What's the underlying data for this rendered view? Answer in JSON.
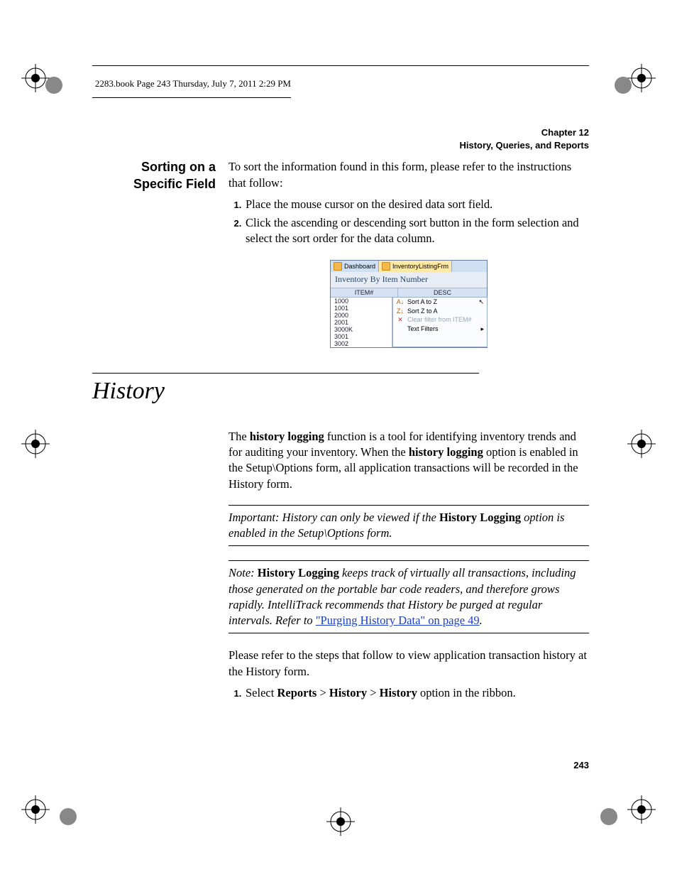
{
  "running_header": "2283.book  Page 243  Thursday, July 7, 2011  2:29 PM",
  "chapter_line1": "Chapter 12",
  "chapter_line2": "History, Queries, and Reports",
  "side_heading": "Sorting on a Specific Field",
  "intro_para": "To sort the information found in this form, please refer to the instructions that follow:",
  "steps": [
    "Place the mouse cursor on the desired data sort field.",
    "Click the ascending or descending sort button in the form selection and select the sort order for the data column."
  ],
  "fig": {
    "tab1": "Dashboard",
    "tab2": "InventoryListingFrm",
    "title": "Inventory By Item Number",
    "col_item": "ITEM#",
    "col_desc": "DESC",
    "items": [
      "1000",
      "1001",
      "2000",
      "2001",
      "3000K",
      "3001",
      "3002"
    ],
    "menu": {
      "sort_az": "Sort A to Z",
      "sort_za": "Sort Z to A",
      "clear": "Clear filter from ITEM#",
      "text_filters": "Text Filters"
    }
  },
  "section_title": "History",
  "history_para_parts": {
    "p1a": "The ",
    "p1b": "history logging",
    "p1c": " function is a tool for identifying inventory trends and for auditing your inventory. When the ",
    "p1d": "history logging",
    "p1e": " option is enabled in the Setup\\Options form, all application transactions will be recorded in the History form."
  },
  "important": {
    "label": "Important:   ",
    "t1": "History can only be viewed if the ",
    "bold": "History Logging",
    "t2": " option is enabled in the Setup\\Options form."
  },
  "note": {
    "label": "Note:   ",
    "bold": "History Logging",
    "t1": " keeps track of virtually all transactions, including those generated on the portable bar code readers, and therefore grows rapidly. IntelliTrack recommends that History be purged at regular intervals. Refer to ",
    "link": "\"Purging History Data\" on page 49",
    "t2": "."
  },
  "para2": "Please refer to the steps that follow to view application transaction history at the History form.",
  "step2_parts": {
    "a": "Select ",
    "b": "Reports",
    "gt": " > ",
    "c": "History",
    "d": "History",
    "e": " option in the ribbon."
  },
  "page_number": "243"
}
